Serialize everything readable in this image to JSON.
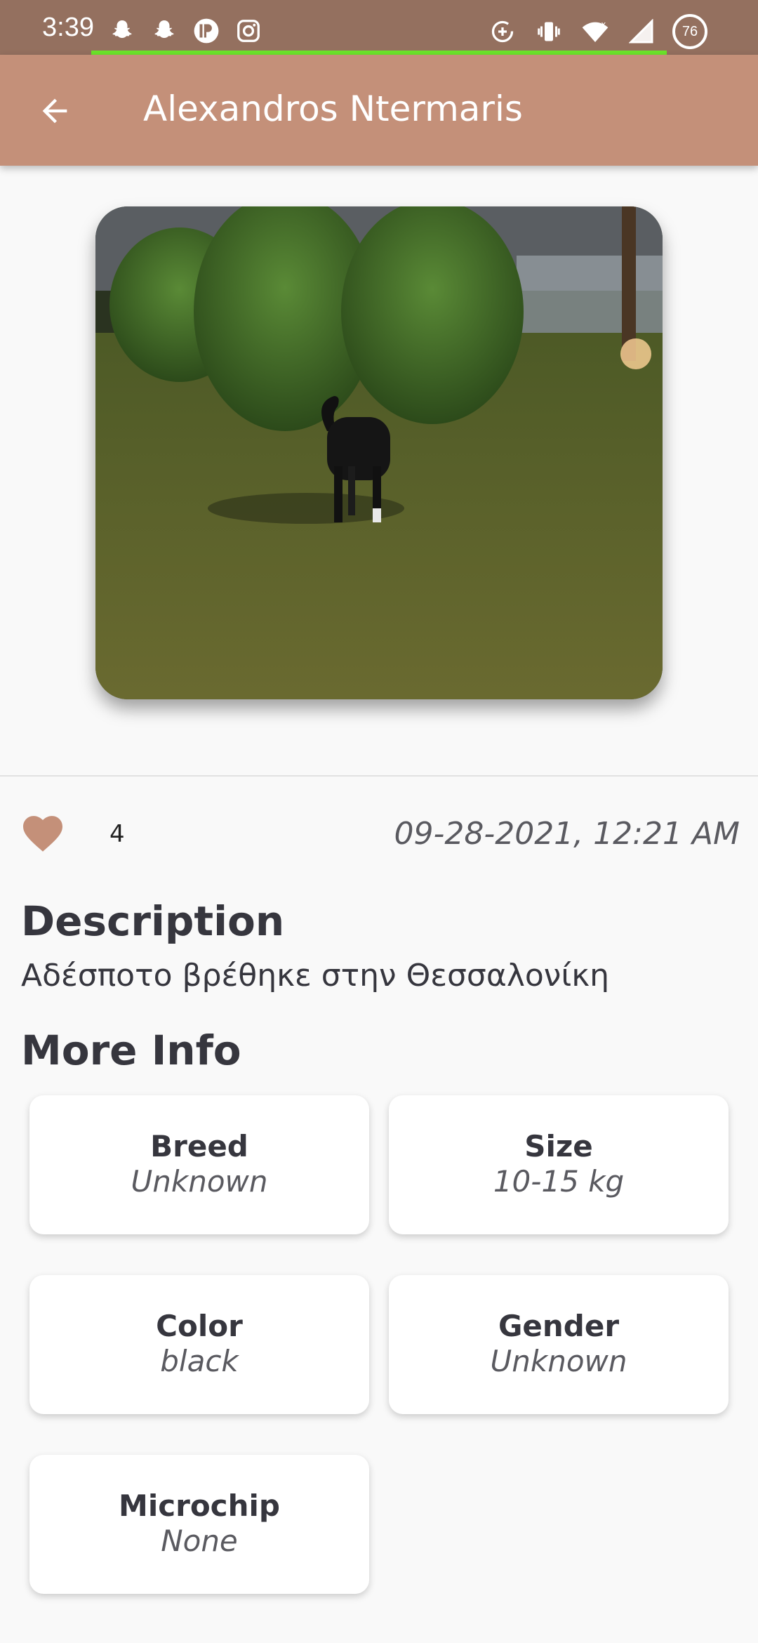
{
  "status_bar": {
    "time": "3:39",
    "left_icons": [
      "snapchat-icon",
      "snapchat-icon",
      "pinterest-like-icon",
      "instagram-icon"
    ],
    "right_icons": [
      "data-saver-icon",
      "vibrate-icon",
      "wifi-icon",
      "signal-icon"
    ],
    "battery": "76"
  },
  "app_bar": {
    "title": "Alexandros Ntermaris",
    "back_icon": "arrow-back-icon"
  },
  "post": {
    "likes": "4",
    "date": "09-28-2021, 12:21 AM",
    "description_heading": "Description",
    "description": "Αδέσποτο βρέθηκε στην Θεσσαλονίκη",
    "more_info_heading": "More Info"
  },
  "info": [
    {
      "label": "Breed",
      "value": "Unknown"
    },
    {
      "label": "Size",
      "value": "10-15 kg"
    },
    {
      "label": "Color",
      "value": "black"
    },
    {
      "label": "Gender",
      "value": "Unknown"
    },
    {
      "label": "Microchip",
      "value": "None"
    }
  ],
  "colors": {
    "status_bar": "#94705f",
    "app_bar": "#c49079",
    "heart": "#c49079",
    "progress": "#6ce52a"
  }
}
